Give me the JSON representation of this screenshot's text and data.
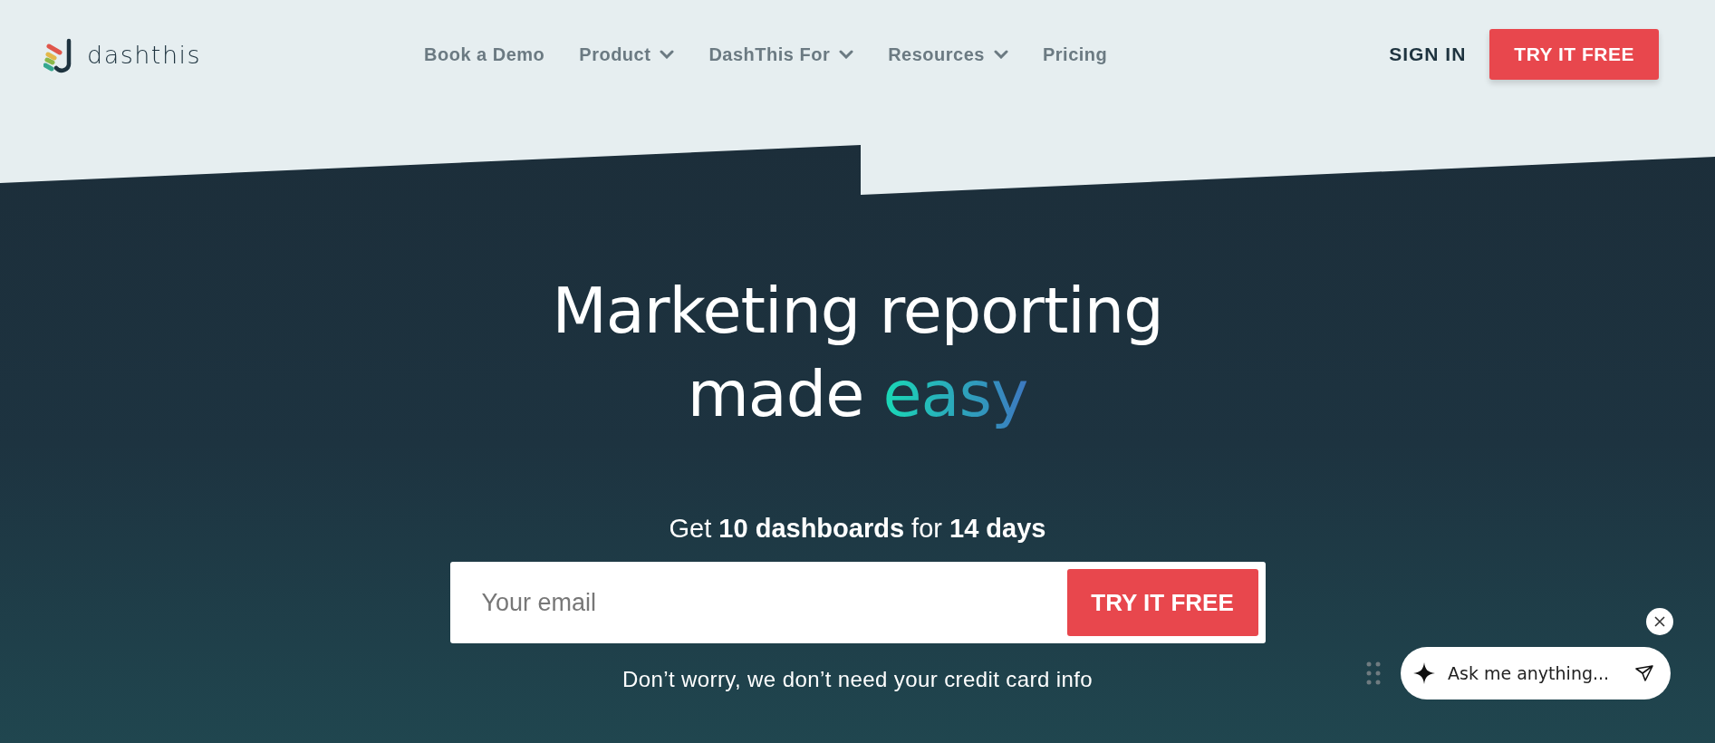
{
  "header": {
    "logo": {
      "text": "dashthis"
    },
    "nav": [
      {
        "label": "Book a Demo",
        "has_menu": false
      },
      {
        "label": "Product",
        "has_menu": true
      },
      {
        "label": "DashThis For",
        "has_menu": true
      },
      {
        "label": "Resources",
        "has_menu": true
      },
      {
        "label": "Pricing",
        "has_menu": false
      }
    ],
    "sign_in": "SIGN IN",
    "cta": "TRY IT FREE"
  },
  "hero": {
    "title_line1": "Marketing reporting",
    "title_line2": "made",
    "title_highlight": "easy",
    "subtitle": "Get **10 dashboards** for **14 days**",
    "email": {
      "placeholder": "Your email"
    },
    "submit": "TRY IT FREE",
    "note": "Don’t worry, we don’t need your credit card info"
  },
  "chat": {
    "placeholder": "Ask me anything..."
  }
}
